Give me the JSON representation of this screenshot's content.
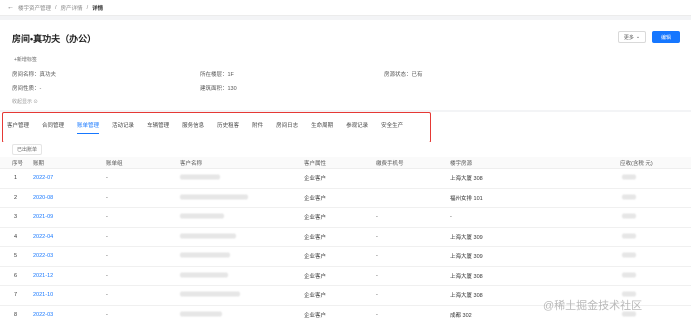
{
  "breadcrumb": {
    "back": "←",
    "items": [
      "楼宇资产管理",
      "房产详情",
      "详情"
    ]
  },
  "header": {
    "title": "房间•真功夫（办公）",
    "more_label": "更多",
    "edit_label": "编辑",
    "add_tag": "+新增标签",
    "collapse": "收起显示"
  },
  "fields": [
    {
      "text": "房间名称：真功夫"
    },
    {
      "text": "所在楼层：1F"
    },
    {
      "text": "房源状态：已有"
    },
    {
      "text": "房间性质：-"
    },
    {
      "text": "建筑面积：130"
    }
  ],
  "tabs": [
    {
      "label": "客户管理"
    },
    {
      "label": "合同管理"
    },
    {
      "label": "账单管理",
      "active": true
    },
    {
      "label": "活动记录"
    },
    {
      "label": "车辆管理"
    },
    {
      "label": "服务信息"
    },
    {
      "label": "历史租客"
    },
    {
      "label": "附件"
    },
    {
      "label": "房间日志"
    },
    {
      "label": "生命周期"
    },
    {
      "label": "参观记录"
    },
    {
      "label": "安全生产"
    }
  ],
  "filter_label": "已出账单",
  "table": {
    "headers": [
      "序号",
      "账期",
      "账单组",
      "客户名称",
      "客户属性",
      "缴费手机号",
      "楼宇房源",
      "应收(含税 元)"
    ],
    "rows": [
      {
        "idx": "1",
        "period": "2022-07",
        "group": "-",
        "attr": "企业客户",
        "phone": "",
        "room": "上海大厦 308"
      },
      {
        "idx": "2",
        "period": "2020-08",
        "group": "-",
        "attr": "企业客户",
        "phone": "",
        "room": "福州女排 101"
      },
      {
        "idx": "3",
        "period": "2021-09",
        "group": "-",
        "attr": "企业客户",
        "phone": "-",
        "room": "-"
      },
      {
        "idx": "4",
        "period": "2022-04",
        "group": "-",
        "attr": "企业客户",
        "phone": "-",
        "room": "上海大厦 309"
      },
      {
        "idx": "5",
        "period": "2022-03",
        "group": "-",
        "attr": "企业客户",
        "phone": "-",
        "room": "上海大厦 309"
      },
      {
        "idx": "6",
        "period": "2021-12",
        "group": "-",
        "attr": "企业客户",
        "phone": "-",
        "room": "上海大厦 308"
      },
      {
        "idx": "7",
        "period": "2021-10",
        "group": "-",
        "attr": "企业客户",
        "phone": "-",
        "room": "上海大厦 308"
      },
      {
        "idx": "8",
        "period": "2022-03",
        "group": "-",
        "attr": "企业客户",
        "phone": "-",
        "room": "成都 302"
      }
    ]
  },
  "watermark": "@稀土掘金技术社区"
}
